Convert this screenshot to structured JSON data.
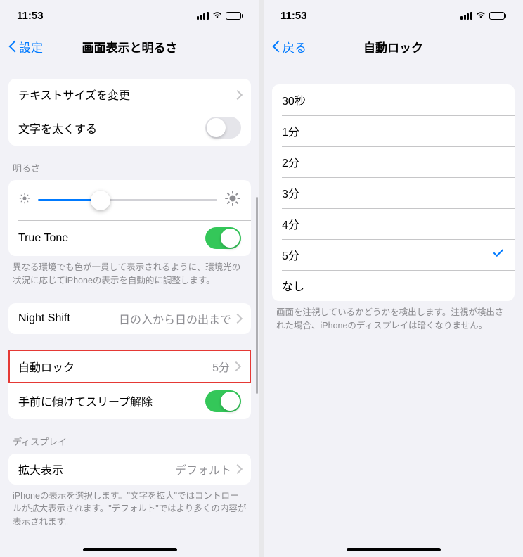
{
  "left": {
    "status": {
      "time": "11:53"
    },
    "nav": {
      "back": "設定",
      "title": "画面表示と明るさ"
    },
    "text_group": {
      "change_size": "テキストサイズを変更",
      "bold": "文字を太くする",
      "bold_on": false
    },
    "brightness": {
      "header": "明るさ",
      "value_pct": 35,
      "truetone_label": "True Tone",
      "truetone_on": true,
      "footer": "異なる環境でも色が一貫して表示されるように、環境光の状況に応じてiPhoneの表示を自動的に調整します。"
    },
    "nightshift": {
      "label": "Night Shift",
      "value": "日の入から日の出まで"
    },
    "autolock": {
      "label": "自動ロック",
      "value": "5分"
    },
    "raise": {
      "label": "手前に傾けてスリープ解除",
      "on": true
    },
    "display": {
      "header": "ディスプレイ",
      "zoom_label": "拡大表示",
      "zoom_value": "デフォルト",
      "footer": "iPhoneの表示を選択します。\"文字を拡大\"ではコントロールが拡大表示されます。\"デフォルト\"ではより多くの内容が表示されます。"
    }
  },
  "right": {
    "status": {
      "time": "11:53"
    },
    "nav": {
      "back": "戻る",
      "title": "自動ロック"
    },
    "options": [
      {
        "label": "30秒",
        "selected": false
      },
      {
        "label": "1分",
        "selected": false
      },
      {
        "label": "2分",
        "selected": false
      },
      {
        "label": "3分",
        "selected": false
      },
      {
        "label": "4分",
        "selected": false
      },
      {
        "label": "5分",
        "selected": true
      },
      {
        "label": "なし",
        "selected": false
      }
    ],
    "footer": "画面を注視しているかどうかを検出します。注視が検出された場合、iPhoneのディスプレイは暗くなりません。"
  }
}
